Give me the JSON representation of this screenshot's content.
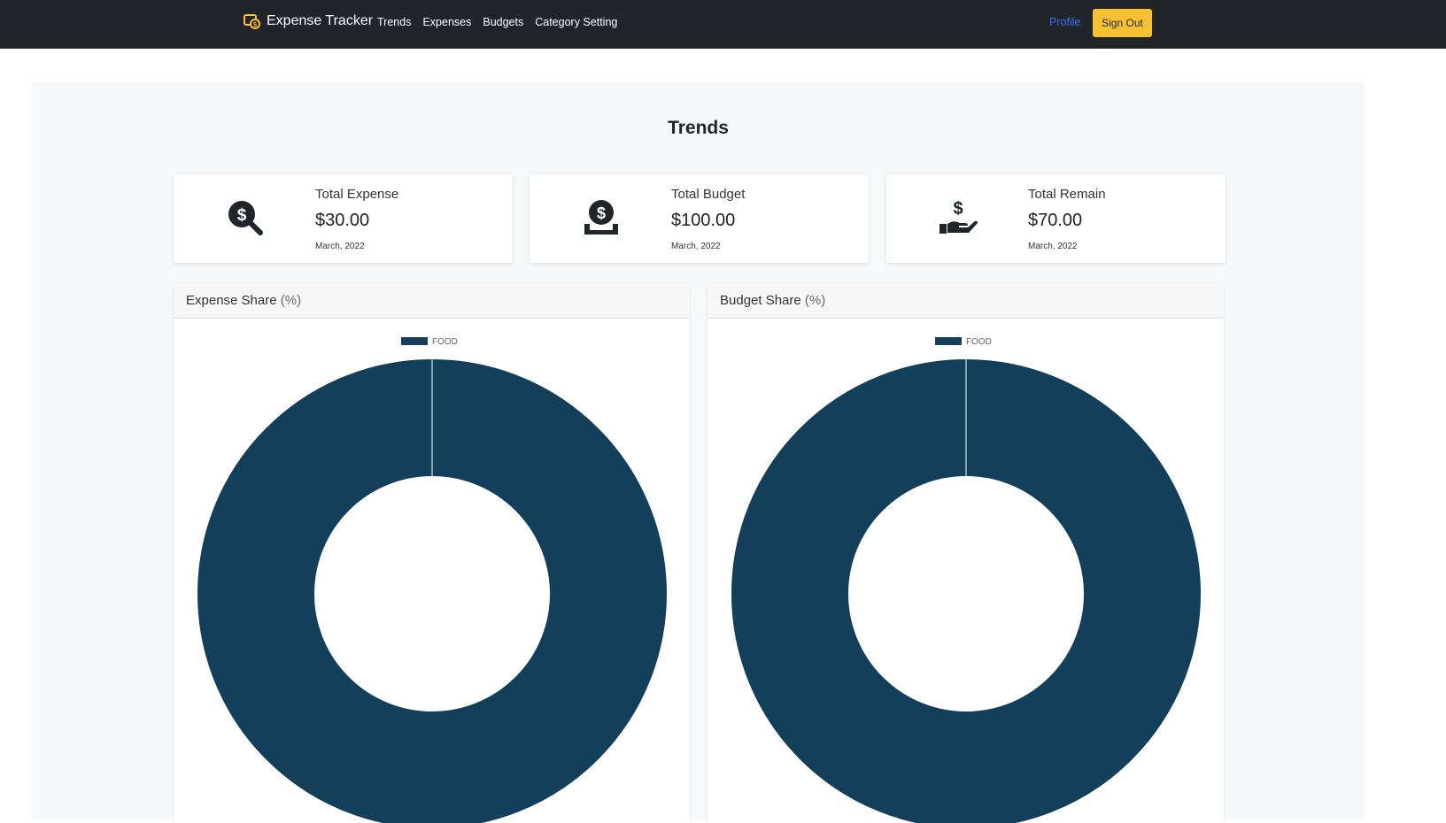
{
  "nav": {
    "brand": "Expense Tracker",
    "links": [
      "Trends",
      "Expenses",
      "Budgets",
      "Category Setting"
    ],
    "profile": "Profile",
    "sign_out": "Sign Out"
  },
  "page": {
    "title": "Trends"
  },
  "stats": [
    {
      "label": "Total Expense",
      "value": "$30.00",
      "date": "March, 2022",
      "icon": "search-dollar-icon"
    },
    {
      "label": "Total Budget",
      "value": "$100.00",
      "date": "March, 2022",
      "icon": "donate-icon"
    },
    {
      "label": "Total Remain",
      "value": "$70.00",
      "date": "March, 2022",
      "icon": "hand-holding-usd-icon"
    }
  ],
  "charts": [
    {
      "title": "Expense Share",
      "suffix": "(%)"
    },
    {
      "title": "Budget Share",
      "suffix": "(%)"
    }
  ],
  "chart_data": [
    {
      "type": "pie",
      "title": "Expense Share (%)",
      "categories": [
        "FOOD"
      ],
      "values": [
        100
      ],
      "colors": [
        "#133f5a"
      ],
      "legend": "top"
    },
    {
      "type": "pie",
      "title": "Budget Share (%)",
      "categories": [
        "FOOD"
      ],
      "values": [
        100
      ],
      "colors": [
        "#133f5a"
      ],
      "legend": "top"
    }
  ],
  "colors": {
    "navbar": "#212529",
    "accent": "#f7c232",
    "link": "#3d6ef5",
    "chart": "#133f5a"
  }
}
